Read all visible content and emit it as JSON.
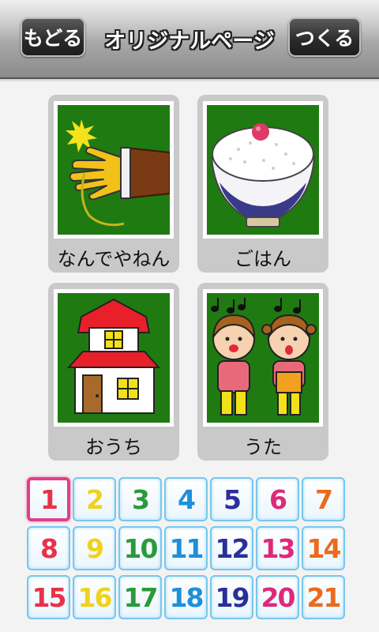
{
  "header": {
    "back_label": "もどる",
    "title": "オリジナルページ",
    "make_label": "つくる"
  },
  "cards": [
    {
      "label": "なんでやねん",
      "icon": "slap-hand-icon"
    },
    {
      "label": "ごはん",
      "icon": "rice-bowl-icon"
    },
    {
      "label": "おうち",
      "icon": "house-icon"
    },
    {
      "label": "うた",
      "icon": "singing-children-icon"
    }
  ],
  "pages": {
    "selected": "1",
    "items": [
      {
        "n": "1",
        "color": "#e8324a"
      },
      {
        "n": "2",
        "color": "#f0d21a"
      },
      {
        "n": "3",
        "color": "#2a9a3a"
      },
      {
        "n": "4",
        "color": "#1e8fd8"
      },
      {
        "n": "5",
        "color": "#2a2f9a"
      },
      {
        "n": "6",
        "color": "#e0287a"
      },
      {
        "n": "7",
        "color": "#ec6a1e"
      },
      {
        "n": "8",
        "color": "#e8324a"
      },
      {
        "n": "9",
        "color": "#f0d21a"
      },
      {
        "n": "10",
        "color": "#2a9a3a"
      },
      {
        "n": "11",
        "color": "#1e8fd8"
      },
      {
        "n": "12",
        "color": "#2a2f9a"
      },
      {
        "n": "13",
        "color": "#e0287a"
      },
      {
        "n": "14",
        "color": "#ec6a1e"
      },
      {
        "n": "15",
        "color": "#e8324a"
      },
      {
        "n": "16",
        "color": "#f0d21a"
      },
      {
        "n": "17",
        "color": "#2a9a3a"
      },
      {
        "n": "18",
        "color": "#1e8fd8"
      },
      {
        "n": "19",
        "color": "#2a2f9a"
      },
      {
        "n": "20",
        "color": "#e0287a"
      },
      {
        "n": "21",
        "color": "#ec6a1e"
      }
    ]
  }
}
